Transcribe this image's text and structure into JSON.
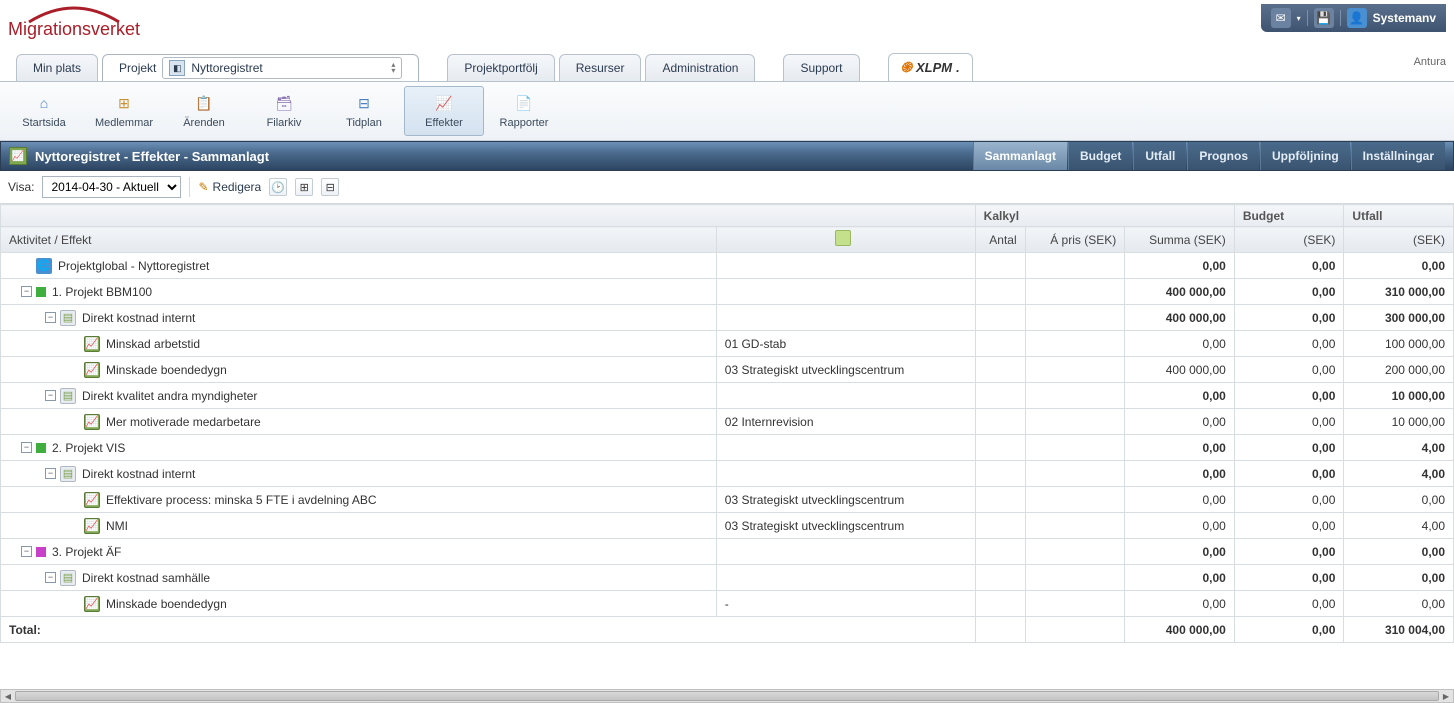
{
  "logo_text": "Migrationsverket",
  "header_user": "Systemanv",
  "antura_label": "Antura",
  "main_tabs": {
    "min_plats": "Min plats",
    "projekt": "Projekt",
    "portfolj": "Projektportfölj",
    "resurser": "Resurser",
    "admin": "Administration",
    "support": "Support",
    "project_name": "Nyttoregistret",
    "xlpm": "XLPM"
  },
  "toolbar": {
    "startsida": "Startsida",
    "medlemmar": "Medlemmar",
    "arenden": "Ärenden",
    "filarkiv": "Filarkiv",
    "tidplan": "Tidplan",
    "effekter": "Effekter",
    "rapporter": "Rapporter"
  },
  "page_title": "Nyttoregistret - Effekter - Sammanlagt",
  "page_tabs": {
    "sammanlagt": "Sammanlagt",
    "budget": "Budget",
    "utfall": "Utfall",
    "prognos": "Prognos",
    "uppfoljning": "Uppföljning",
    "installningar": "Inställningar"
  },
  "filter": {
    "visa_label": "Visa:",
    "date_value": "2014-04-30 - Aktuell",
    "edit_label": "Redigera"
  },
  "columns": {
    "activity": "Aktivitet / Effekt",
    "group_kalkyl": "Kalkyl",
    "group_budget": "Budget",
    "group_utfall": "Utfall",
    "antal": "Antal",
    "apris": "Á pris (SEK)",
    "summa": "Summa (SEK)",
    "sek1": "(SEK)",
    "sek2": "(SEK)"
  },
  "rows": [
    {
      "depth": 0,
      "exp": "",
      "icon": "globe",
      "label": "Projektglobal - Nyttoregistret",
      "dept": "",
      "summa": "0,00",
      "budget": "0,00",
      "utfall": "0,00",
      "bold": true
    },
    {
      "depth": 0,
      "exp": "-",
      "sq": "green",
      "label": "1. Projekt BBM100",
      "dept": "",
      "summa": "400 000,00",
      "budget": "0,00",
      "utfall": "310 000,00",
      "bold": true
    },
    {
      "depth": 1,
      "exp": "-",
      "icon": "doc",
      "label": "Direkt kostnad internt",
      "dept": "",
      "summa": "400 000,00",
      "budget": "0,00",
      "utfall": "300 000,00",
      "bold": true
    },
    {
      "depth": 2,
      "exp": "",
      "icon": "chart",
      "label": "Minskad arbetstid",
      "dept": "01 GD-stab",
      "summa": "0,00",
      "budget": "0,00",
      "utfall": "100 000,00"
    },
    {
      "depth": 2,
      "exp": "",
      "icon": "chart",
      "label": "Minskade boendedygn",
      "dept": "03 Strategiskt utvecklingscentrum",
      "summa": "400 000,00",
      "budget": "0,00",
      "utfall": "200 000,00"
    },
    {
      "depth": 1,
      "exp": "-",
      "icon": "doc",
      "label": "Direkt kvalitet andra myndigheter",
      "dept": "",
      "summa": "0,00",
      "budget": "0,00",
      "utfall": "10 000,00",
      "bold": true
    },
    {
      "depth": 2,
      "exp": "",
      "icon": "chart",
      "label": "Mer motiverade medarbetare",
      "dept": "02 Internrevision",
      "summa": "0,00",
      "budget": "0,00",
      "utfall": "10 000,00"
    },
    {
      "depth": 0,
      "exp": "-",
      "sq": "green",
      "label": "2. Projekt VIS",
      "dept": "",
      "summa": "0,00",
      "budget": "0,00",
      "utfall": "4,00",
      "bold": true
    },
    {
      "depth": 1,
      "exp": "-",
      "icon": "doc",
      "label": "Direkt kostnad internt",
      "dept": "",
      "summa": "0,00",
      "budget": "0,00",
      "utfall": "4,00",
      "bold": true
    },
    {
      "depth": 2,
      "exp": "",
      "icon": "chart",
      "label": "Effektivare process: minska 5 FTE i avdelning ABC",
      "dept": "03 Strategiskt utvecklingscentrum",
      "summa": "0,00",
      "budget": "0,00",
      "utfall": "0,00"
    },
    {
      "depth": 2,
      "exp": "",
      "icon": "chart",
      "label": "NMI",
      "dept": "03 Strategiskt utvecklingscentrum",
      "summa": "0,00",
      "budget": "0,00",
      "utfall": "4,00"
    },
    {
      "depth": 0,
      "exp": "-",
      "sq": "magenta",
      "label": "3. Projekt ÄF",
      "dept": "",
      "summa": "0,00",
      "budget": "0,00",
      "utfall": "0,00",
      "bold": true
    },
    {
      "depth": 1,
      "exp": "-",
      "icon": "doc",
      "label": "Direkt kostnad samhälle",
      "dept": "",
      "summa": "0,00",
      "budget": "0,00",
      "utfall": "0,00",
      "bold": true
    },
    {
      "depth": 2,
      "exp": "",
      "icon": "chart",
      "label": "Minskade boendedygn",
      "dept": "-",
      "summa": "0,00",
      "budget": "0,00",
      "utfall": "0,00"
    }
  ],
  "total": {
    "label": "Total:",
    "summa": "400 000,00",
    "budget": "0,00",
    "utfall": "310 004,00"
  }
}
